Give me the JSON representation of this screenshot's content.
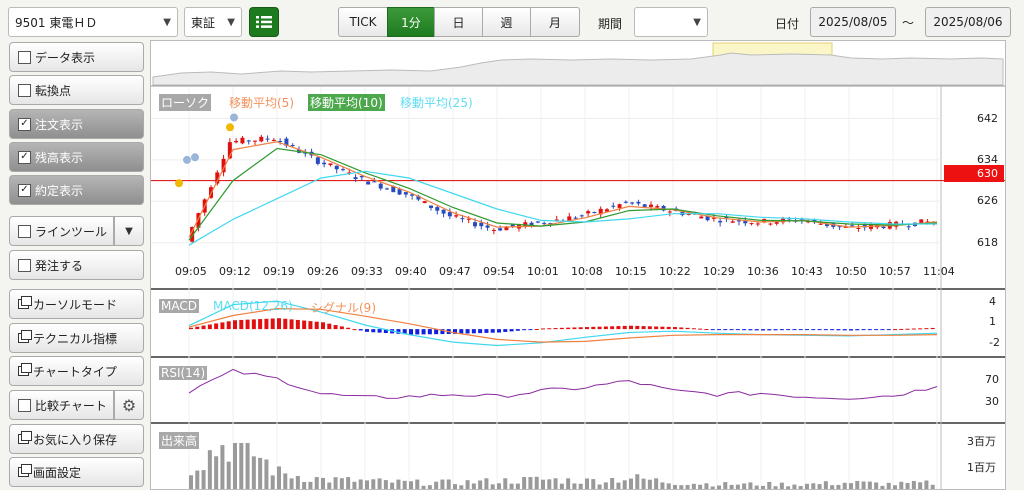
{
  "header": {
    "symbol": "9501 東電ＨＤ",
    "market": "東証",
    "tabs": [
      "TICK",
      "1分",
      "日",
      "週",
      "月"
    ],
    "active_tab": "1分",
    "period_label": "期間",
    "period_value": "",
    "date_label": "日付",
    "date_from": "2025/08/05",
    "date_sep": "～",
    "date_to": "2025/08/06"
  },
  "sidebar": {
    "items": [
      {
        "label": "データ表示",
        "checked": false
      },
      {
        "label": "転換点",
        "checked": false
      },
      {
        "label": "注文表示",
        "checked": true
      },
      {
        "label": "残高表示",
        "checked": true
      },
      {
        "label": "約定表示",
        "checked": true
      },
      {
        "label": "ラインツール",
        "checked": false
      },
      {
        "label": "発注する",
        "checked": false
      },
      {
        "label": "カーソルモード"
      },
      {
        "label": "テクニカル指標"
      },
      {
        "label": "チャートタイプ"
      },
      {
        "label": "比較チャート",
        "checked": false
      },
      {
        "label": "お気に入り保存"
      },
      {
        "label": "画面設定"
      }
    ]
  },
  "legend": {
    "candle": "ローソク",
    "ma5": "移動平均(5)",
    "ma10": "移動平均(10)",
    "ma25": "移動平均(25)",
    "macd": "MACD",
    "macd_param": "MACD(12,26)",
    "signal": "シグナル(9)",
    "rsi": "RSI(14)",
    "volume": "出来高"
  },
  "colors": {
    "accent_green": "#1e7a1e",
    "candle_up": "#e01010",
    "candle_down": "#2a4bbf",
    "ma5": "#f08040",
    "ma10": "#2e9a2e",
    "ma25": "#40d8f0",
    "price_line": "#e00000",
    "rsi": "#8a2aa0"
  },
  "chart_data": [
    {
      "type": "candlestick",
      "title": "",
      "x": [
        "09:05",
        "09:12",
        "09:19",
        "09:26",
        "09:33",
        "09:40",
        "09:47",
        "09:54",
        "10:01",
        "10:08",
        "10:15",
        "10:22",
        "10:29",
        "10:36",
        "10:43",
        "10:50",
        "10:57",
        "11:04"
      ],
      "y_ticks": [
        642,
        634,
        626,
        618
      ],
      "ylim": [
        616,
        645
      ],
      "current_price": 630,
      "close": [
        618.2,
        637.5,
        638.2,
        633.8,
        630.2,
        627.4,
        623.1,
        620.6,
        621.8,
        623.2,
        625.7,
        624.2,
        622.6,
        622.0,
        622.4,
        620.8,
        621.4,
        622.1
      ],
      "series": [
        {
          "name": "移動平均(5)",
          "values": [
            619.0,
            636.0,
            637.5,
            634.5,
            630.8,
            627.8,
            623.8,
            621.0,
            621.2,
            622.8,
            625.0,
            624.4,
            622.8,
            622.0,
            622.3,
            621.0,
            621.3,
            622.0
          ]
        },
        {
          "name": "移動平均(10)",
          "values": [
            618.5,
            630.0,
            636.2,
            635.0,
            631.5,
            628.5,
            624.8,
            621.8,
            621.2,
            622.0,
            624.2,
            624.5,
            623.2,
            622.3,
            622.2,
            621.6,
            621.4,
            621.8
          ]
        },
        {
          "name": "移動平均(25)",
          "values": [
            617.5,
            622.5,
            626.5,
            630.5,
            631.8,
            630.5,
            627.5,
            624.5,
            622.3,
            622.0,
            622.6,
            623.6,
            623.6,
            622.9,
            622.6,
            622.0,
            621.6,
            621.6
          ]
        }
      ]
    },
    {
      "type": "bar",
      "title": "MACD",
      "y_ticks": [
        4,
        1,
        -2
      ],
      "ylim": [
        -3.5,
        5
      ],
      "histogram": [
        0.2,
        1.3,
        1.6,
        1.0,
        -0.4,
        -0.8,
        -0.7,
        -0.5,
        0.1,
        0.3,
        0.5,
        0.3,
        -0.1,
        -0.2,
        -0.1,
        -0.2,
        0.0,
        0.2
      ],
      "series": [
        {
          "name": "MACD(12,26)",
          "values": [
            0.5,
            3.6,
            4.1,
            2.5,
            0.6,
            -0.8,
            -1.9,
            -2.4,
            -2.0,
            -1.2,
            -0.5,
            -0.3,
            -0.6,
            -0.8,
            -0.9,
            -1.0,
            -0.8,
            -0.6
          ]
        },
        {
          "name": "シグナル(9)",
          "values": [
            0.3,
            2.0,
            3.0,
            2.9,
            1.9,
            0.8,
            -0.5,
            -1.5,
            -1.9,
            -1.8,
            -1.3,
            -0.9,
            -0.8,
            -0.8,
            -0.8,
            -0.9,
            -0.9,
            -0.8
          ]
        }
      ]
    },
    {
      "type": "line",
      "title": "RSI(14)",
      "y_ticks": [
        70,
        30
      ],
      "ylim": [
        0,
        100
      ],
      "series": [
        {
          "name": "RSI(14)",
          "values": [
            50,
            85,
            72,
            45,
            38,
            40,
            44,
            40,
            50,
            56,
            68,
            50,
            44,
            46,
            40,
            38,
            42,
            58
          ]
        }
      ]
    },
    {
      "type": "bar",
      "title": "出来高",
      "y_ticks": [
        "3百万",
        "1百万"
      ],
      "values": [
        1.5,
        3.2,
        1.0,
        0.6,
        0.5,
        0.4,
        0.4,
        0.5,
        0.6,
        0.5,
        0.7,
        0.4,
        0.3,
        0.3,
        0.3,
        0.4,
        0.3,
        0.4
      ]
    }
  ]
}
